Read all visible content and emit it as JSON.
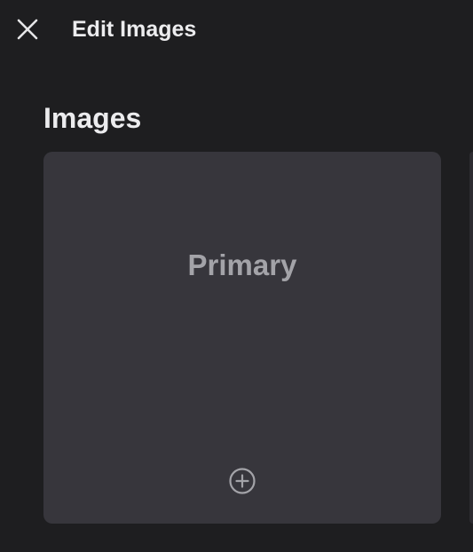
{
  "header": {
    "title": "Edit Images",
    "close_icon": "close-icon"
  },
  "section": {
    "title": "Images"
  },
  "image_slots": [
    {
      "label": "Primary",
      "add_icon": "plus-circle-icon"
    }
  ],
  "colors": {
    "background": "#1e1e20",
    "card": "#37363c",
    "text_primary": "#ececee",
    "text_muted": "#a3a3a8"
  }
}
